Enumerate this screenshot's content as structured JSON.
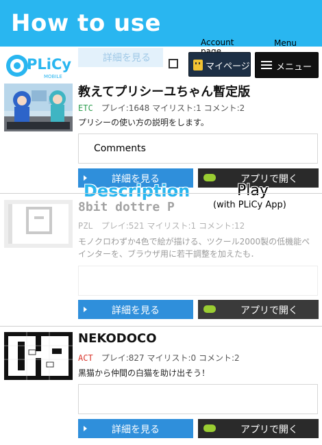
{
  "banner": {
    "title": "How to use"
  },
  "header": {
    "logo_text": "PLiCy",
    "logo_sub": "MOBILE",
    "detail_label": "詳細を見る",
    "mypage_label": "マイページ",
    "menu_label": "メニュー",
    "annotation_account": "Account page",
    "annotation_menu": "Menu"
  },
  "annotations": {
    "description": "Description",
    "play": "Play",
    "play_sub": "(with PLiCy App)"
  },
  "items": [
    {
      "title": "教えてプリシーユちゃん暫定版",
      "genre": "ETC",
      "genre_color": "#2e9e4f",
      "stats": "プレイ:1648 マイリスト:1 コメント:2",
      "description": "プリシーの使い方の説明をします。",
      "comment_label": "Comments",
      "detail_label": "詳細を見る",
      "app_label": "アプリで開く"
    },
    {
      "title": "8bit dottre P",
      "genre": "PZL",
      "genre_color": "#555555",
      "stats": "プレイ:521 マイリスト:1 コメント:12",
      "description": "モノクロわずか4色で絵が描ける、ツクール2000製の低機能ペインターを、ブラウザ用に若干調整を加えたも．",
      "comment_label": "",
      "detail_label": "詳細を見る",
      "app_label": "アプリで開く"
    },
    {
      "title": "NEKODOCO",
      "genre": "ACT",
      "genre_color": "#d9342b",
      "stats": "プレイ:827 マイリスト:0 コメント:2",
      "description": "黒猫から仲間の白猫を助け出そう！",
      "comment_label": "",
      "detail_label": "詳細を見る",
      "app_label": "アプリで開く"
    }
  ],
  "colors": {
    "banner": "#29b6f0",
    "detail_button": "#2f8fdb",
    "app_button": "#2a2a2a",
    "mypage_button": "#1d2f45"
  }
}
